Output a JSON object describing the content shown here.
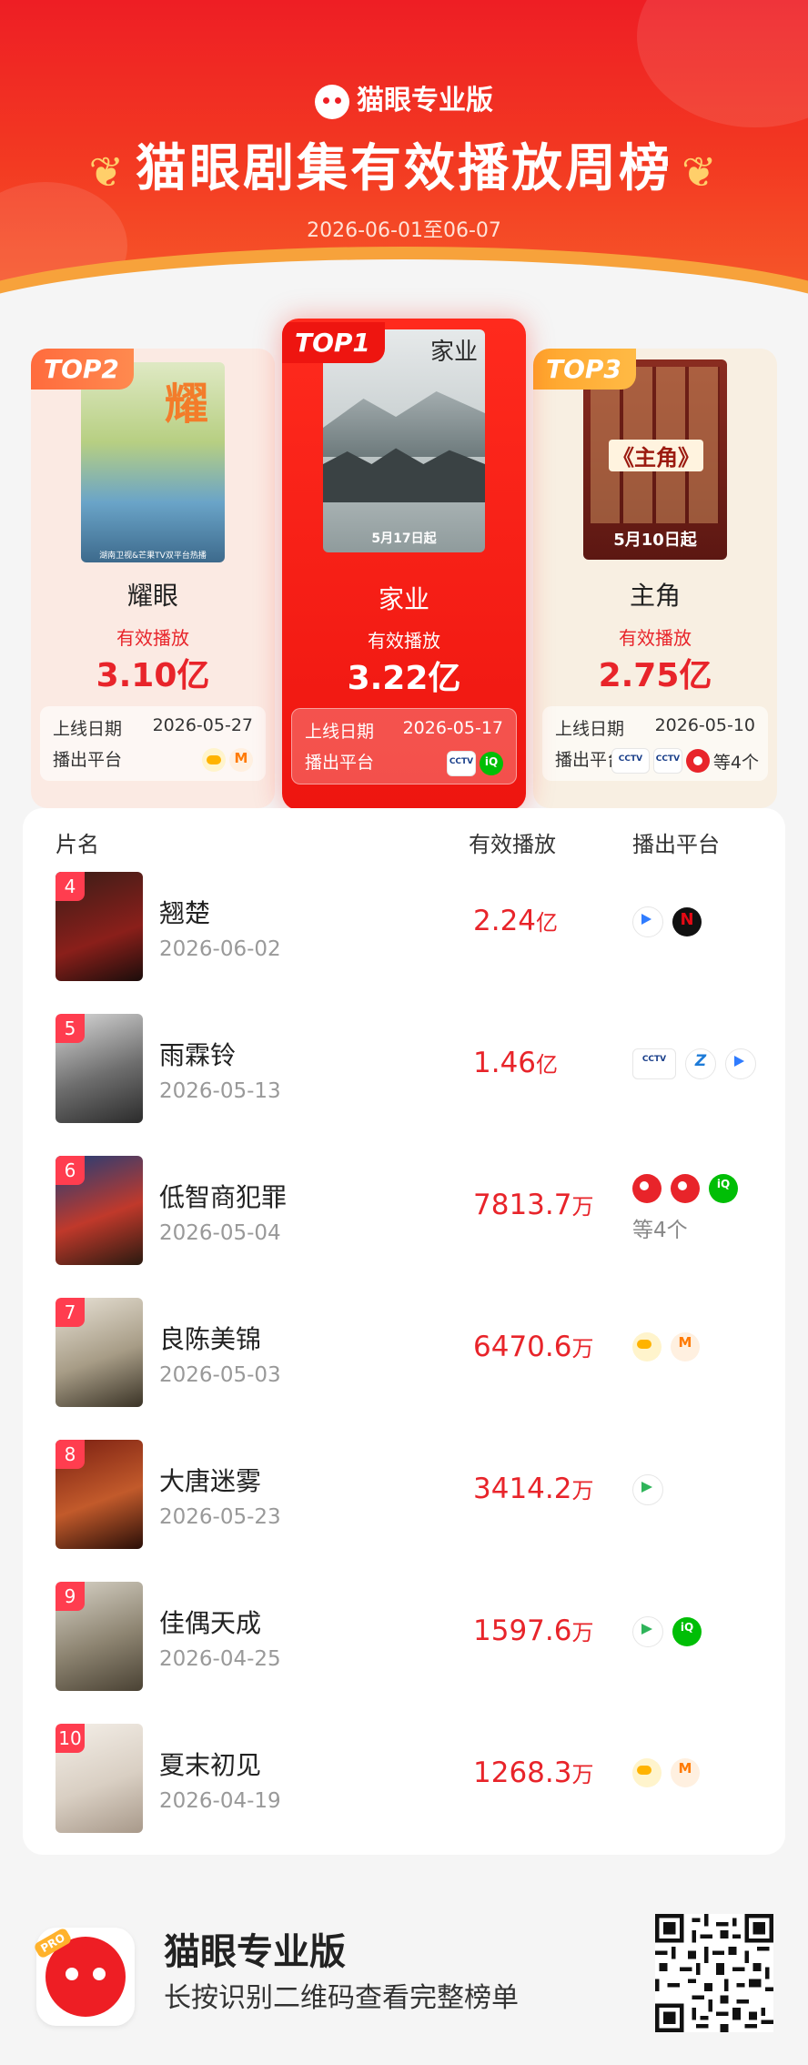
{
  "header": {
    "brand": "猫眼专业版",
    "title": "猫眼剧集有效播放周榜",
    "date_range": "2026-06-01至06-07",
    "colors": {
      "primary": "#ee1e24",
      "accent_value": "#e8242a"
    }
  },
  "top": [
    {
      "tag": "TOP1",
      "name": "家业",
      "value_label": "有效播放",
      "value": "3.22亿",
      "poster_title": "家业",
      "poster_date": "5月17日起",
      "release_label": "上线日期",
      "release_date": "2026-05-17",
      "platform_label": "播出平台",
      "platforms": [
        "cctv-icon",
        "iqiyi-icon"
      ]
    },
    {
      "tag": "TOP2",
      "name": "耀眼",
      "value_label": "有效播放",
      "value": "3.10亿",
      "poster_title": "耀",
      "poster_foot": "湖南卫视&芒果TV双平台热播",
      "release_label": "上线日期",
      "release_date": "2026-05-27",
      "platform_label": "播出平台",
      "platforms": [
        "mango-icon",
        "mgtv-icon"
      ]
    },
    {
      "tag": "TOP3",
      "name": "主角",
      "value_label": "有效播放",
      "value": "2.75亿",
      "poster_title": "《主角》",
      "poster_date": "5月10日起",
      "release_label": "上线日期",
      "release_date": "2026-05-10",
      "platform_label": "播出平台",
      "platforms": [
        "cctv-icon",
        "cctv-red-icon",
        "red-icon"
      ],
      "platform_more": "等4个"
    }
  ],
  "list": {
    "headers": {
      "name": "片名",
      "value": "有效播放",
      "platform": "播出平台"
    },
    "rows": [
      {
        "rank": "4",
        "title": "翘楚",
        "date": "2026-06-02",
        "value": "2.24",
        "unit": "亿",
        "platforms": [
          "youku-icon",
          "netflix-icon"
        ],
        "more": ""
      },
      {
        "rank": "5",
        "title": "雨霖铃",
        "date": "2026-05-13",
        "value": "1.46",
        "unit": "亿",
        "platforms": [
          "cctv-icon",
          "zhejiang-icon",
          "youku-icon"
        ],
        "more": ""
      },
      {
        "rank": "6",
        "title": "低智商犯罪",
        "date": "2026-05-04",
        "value": "7813.7",
        "unit": "万",
        "platforms": [
          "red-icon",
          "red-icon",
          "iqiyi-icon"
        ],
        "more": "等4个"
      },
      {
        "rank": "7",
        "title": "良陈美锦",
        "date": "2026-05-03",
        "value": "6470.6",
        "unit": "万",
        "platforms": [
          "mango-icon",
          "mgtv-icon"
        ],
        "more": ""
      },
      {
        "rank": "8",
        "title": "大唐迷雾",
        "date": "2026-05-23",
        "value": "3414.2",
        "unit": "万",
        "platforms": [
          "tencent-icon"
        ],
        "more": ""
      },
      {
        "rank": "9",
        "title": "佳偶天成",
        "date": "2026-04-25",
        "value": "1597.6",
        "unit": "万",
        "platforms": [
          "tencent-icon",
          "iqiyi-icon"
        ],
        "more": ""
      },
      {
        "rank": "10",
        "title": "夏末初见",
        "date": "2026-04-19",
        "value": "1268.3",
        "unit": "万",
        "platforms": [
          "mango-icon",
          "mgtv-icon"
        ],
        "more": ""
      }
    ]
  },
  "footer": {
    "app_name": "猫眼专业版",
    "subtitle": "长按识别二维码查看完整榜单",
    "badge": "PRO"
  }
}
